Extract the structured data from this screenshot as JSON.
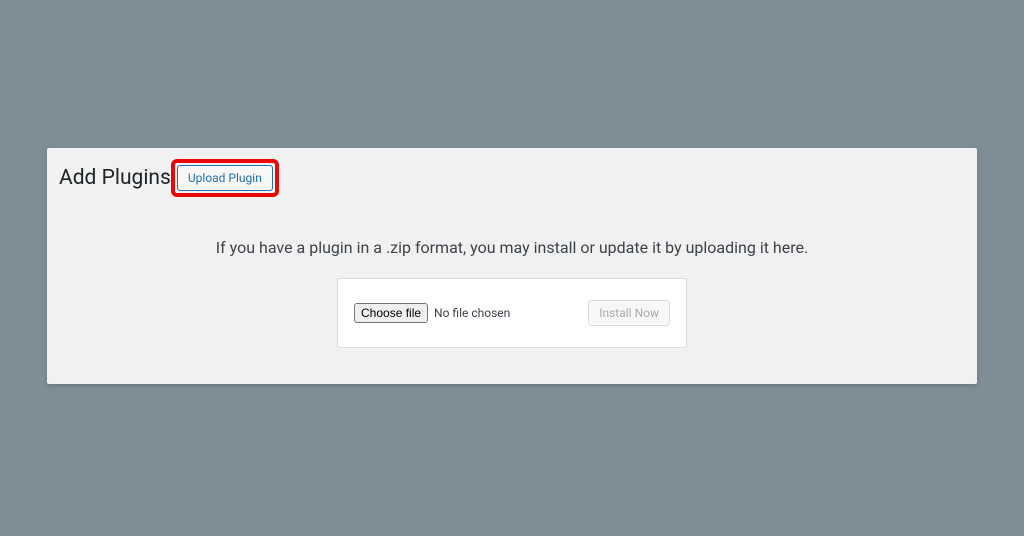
{
  "header": {
    "page_title": "Add Plugins",
    "upload_button_label": "Upload Plugin"
  },
  "main": {
    "instruction_text": "If you have a plugin in a .zip format, you may install or update it by uploading it here.",
    "choose_file_label": "Choose file",
    "file_status_text": "No file chosen",
    "install_button_label": "Install Now"
  }
}
